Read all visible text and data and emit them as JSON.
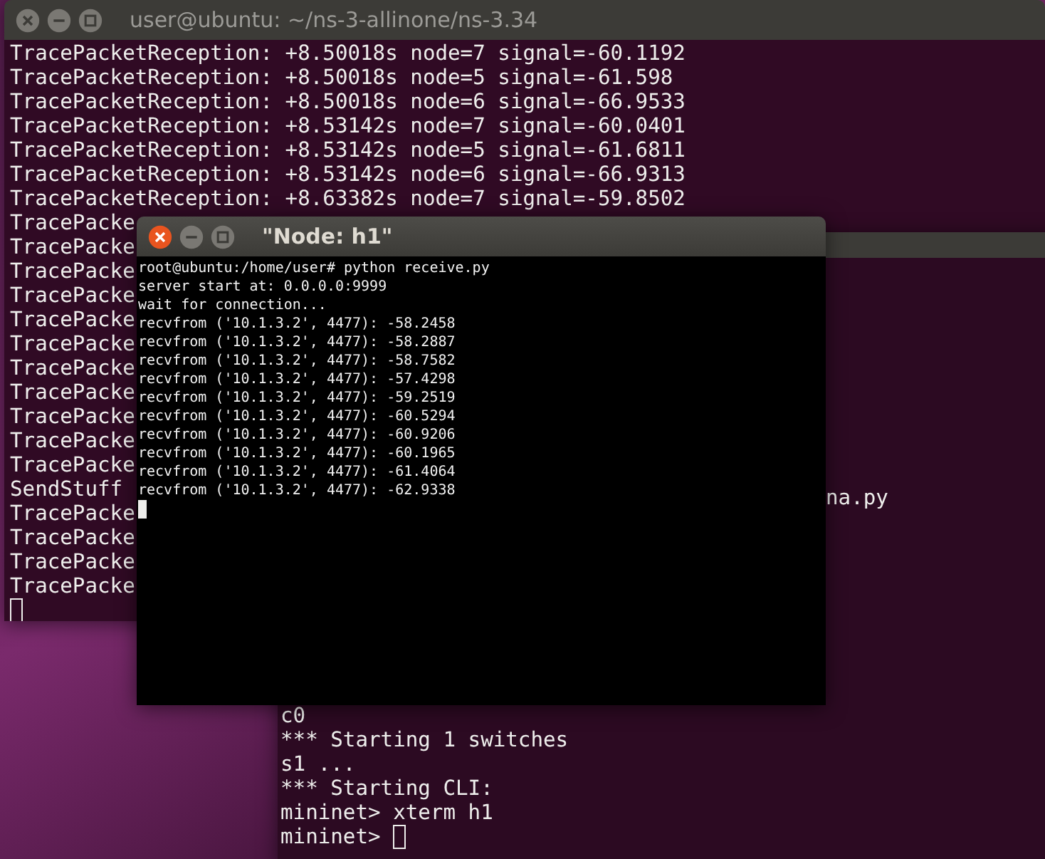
{
  "windows": [
    {
      "title": "user@ubuntu: ~/ns-3-allinone/ns-3.34",
      "active": false,
      "lines": [
        "TracePacketReception: +8.50018s node=7 signal=-60.1192",
        "TracePacketReception: +8.50018s node=5 signal=-61.598",
        "TracePacketReception: +8.50018s node=6 signal=-66.9533",
        "TracePacketReception: +8.53142s node=7 signal=-60.0401",
        "TracePacketReception: +8.53142s node=5 signal=-61.6811",
        "TracePacketReception: +8.53142s node=6 signal=-66.9313",
        "TracePacketReception: +8.63382s node=7 signal=-59.8502",
        "TracePacke",
        "TracePacke",
        "TracePacke",
        "TracePacke",
        "TracePacke",
        "TracePacke",
        "TracePacke",
        "TracePacke",
        "TracePacke",
        "TracePacke",
        "TracePacke",
        "SendStuff",
        "TracePacke",
        "TracePacke",
        "TracePacke",
        "TracePacke"
      ]
    },
    {
      "active": false,
      "lines": [
        "na.py",
        "c0",
        "*** Starting 1 switches",
        "s1 ...",
        "*** Starting CLI:",
        "mininet> xterm h1",
        "mininet> "
      ]
    },
    {
      "title": "\"Node: h1\"",
      "active": true,
      "lines": [
        "root@ubuntu:/home/user# python receive.py",
        "server start at: 0.0.0.0:9999",
        "wait for connection...",
        "recvfrom ('10.1.3.2', 4477): -58.2458",
        "recvfrom ('10.1.3.2', 4477): -58.2887",
        "recvfrom ('10.1.3.2', 4477): -58.7582",
        "recvfrom ('10.1.3.2', 4477): -57.4298",
        "recvfrom ('10.1.3.2', 4477): -59.2519",
        "recvfrom ('10.1.3.2', 4477): -60.5294",
        "recvfrom ('10.1.3.2', 4477): -60.9206",
        "recvfrom ('10.1.3.2', 4477): -60.1965",
        "recvfrom ('10.1.3.2', 4477): -61.4064",
        "recvfrom ('10.1.3.2', 4477): -62.9338"
      ]
    }
  ]
}
